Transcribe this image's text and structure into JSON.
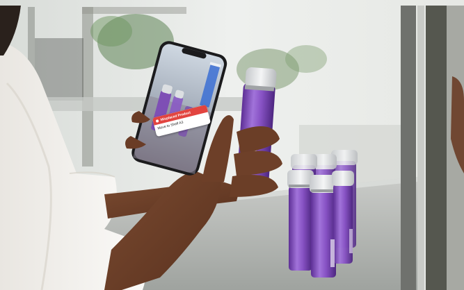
{
  "ar_card": {
    "header": "Misplaced Product",
    "body": "Move to Shelf A3"
  },
  "colors": {
    "alert_red": "#e2443f",
    "product_purple": "#8a4fc4",
    "cap_silver": "#d9dcdf"
  }
}
